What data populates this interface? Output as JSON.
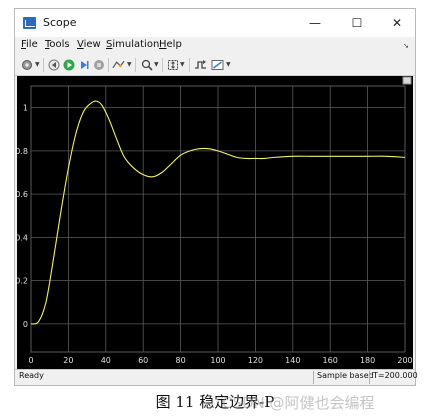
{
  "window": {
    "title": "Scope",
    "controls": {
      "minimize": "—",
      "maximize": "☐",
      "close": "✕"
    }
  },
  "menu": {
    "items": [
      {
        "label": "File",
        "mnemonic": "F",
        "rest": "ile"
      },
      {
        "label": "Tools",
        "mnemonic": "T",
        "rest": "ools"
      },
      {
        "label": "View",
        "mnemonic": "V",
        "rest": "iew"
      },
      {
        "label": "Simulation",
        "mnemonic": "S",
        "rest": "imulation"
      },
      {
        "label": "Help",
        "mnemonic": "H",
        "rest": "elp"
      }
    ]
  },
  "toolbar": {
    "icons": [
      "settings-gear-icon",
      "step-back-icon",
      "run-icon",
      "step-forward-icon",
      "stop-icon",
      "highlight-icon",
      "zoom-icon",
      "autoscale-icon",
      "trigger-icon",
      "measurement-icon"
    ]
  },
  "status": {
    "text": "Ready",
    "mode": "Sample based",
    "time": "T=200.000"
  },
  "caption": {
    "text": "图 11 稳定边界-P"
  },
  "watermark": {
    "text": "CSDN @阿健也会编程"
  },
  "colors": {
    "plot_background": "#000000",
    "grid": "#5a5a5a",
    "trace": "#f2f26a",
    "tick_label": "#e0e0e0"
  },
  "chart_data": {
    "type": "line",
    "title": "",
    "xlabel": "",
    "ylabel": "",
    "xlim": [
      0,
      200
    ],
    "ylim": [
      -0.13,
      1.1
    ],
    "xticks": [
      0,
      20,
      40,
      60,
      80,
      100,
      120,
      140,
      160,
      180,
      200
    ],
    "yticks": [
      0,
      0.2,
      0.4,
      0.6,
      0.8,
      1
    ],
    "ytick_labels": [
      "0",
      "0.2",
      "0.4",
      "0.6",
      "0.8",
      "1"
    ],
    "grid": true,
    "series": [
      {
        "x": [
          0,
          4,
          8,
          12,
          16,
          20,
          24,
          28,
          32,
          35,
          38,
          42,
          46,
          50,
          55,
          60,
          65,
          70,
          75,
          80,
          85,
          90,
          95,
          100,
          105,
          110,
          115,
          120,
          125,
          130,
          140,
          150,
          160,
          170,
          180,
          190,
          200
        ],
        "y": [
          0,
          0.01,
          0.1,
          0.3,
          0.52,
          0.72,
          0.88,
          0.98,
          1.02,
          1.03,
          1.01,
          0.94,
          0.85,
          0.77,
          0.72,
          0.69,
          0.68,
          0.7,
          0.74,
          0.78,
          0.8,
          0.81,
          0.81,
          0.8,
          0.785,
          0.77,
          0.765,
          0.765,
          0.765,
          0.77,
          0.775,
          0.775,
          0.775,
          0.775,
          0.775,
          0.775,
          0.77
        ]
      }
    ]
  }
}
